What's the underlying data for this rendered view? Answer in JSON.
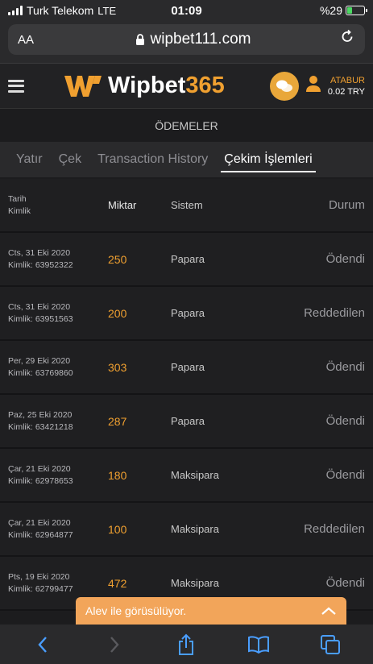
{
  "status_bar": {
    "carrier": "Turk Telekom",
    "network": "LTE",
    "time": "01:09",
    "battery": "%29"
  },
  "browser": {
    "text_size": "AA",
    "url": "wipbet111.com"
  },
  "header": {
    "logo_text": "Wipbet",
    "logo_num": "365",
    "username": "ATABUR",
    "balance": "0.02 TRY"
  },
  "page_title": "ÖDEMELER",
  "tabs": [
    {
      "label": "Yatır"
    },
    {
      "label": "Çek"
    },
    {
      "label": "Transaction History"
    },
    {
      "label": "Çekim İşlemleri"
    }
  ],
  "table": {
    "headers": {
      "date": "Tarih",
      "id": "Kimlik",
      "amount": "Miktar",
      "system": "Sistem",
      "status": "Durum"
    },
    "rows": [
      {
        "date": "Cts, 31 Eki 2020",
        "id": "Kimlik: 63952322",
        "amount": "250",
        "system": "Papara",
        "status": "Ödendi"
      },
      {
        "date": "Cts, 31 Eki 2020",
        "id": "Kimlik: 63951563",
        "amount": "200",
        "system": "Papara",
        "status": "Reddedilen"
      },
      {
        "date": "Per, 29 Eki 2020",
        "id": "Kimlik: 63769860",
        "amount": "303",
        "system": "Papara",
        "status": "Ödendi"
      },
      {
        "date": "Paz, 25 Eki 2020",
        "id": "Kimlik: 63421218",
        "amount": "287",
        "system": "Papara",
        "status": "Ödendi"
      },
      {
        "date": "Çar, 21 Eki 2020",
        "id": "Kimlik: 62978653",
        "amount": "180",
        "system": "Maksipara",
        "status": "Ödendi"
      },
      {
        "date": "Çar, 21 Eki 2020",
        "id": "Kimlik: 62964877",
        "amount": "100",
        "system": "Maksipara",
        "status": "Reddedilen"
      },
      {
        "date": "Pts, 19 Eki 2020",
        "id": "Kimlik: 62799477",
        "amount": "472",
        "system": "Maksipara",
        "status": "Ödendi"
      }
    ]
  },
  "chat": {
    "label": "Alev ile görüsülüyor."
  },
  "colors": {
    "accent": "#f0a030",
    "background": "#1c1c1e",
    "ios_blue": "#4a9eff"
  }
}
